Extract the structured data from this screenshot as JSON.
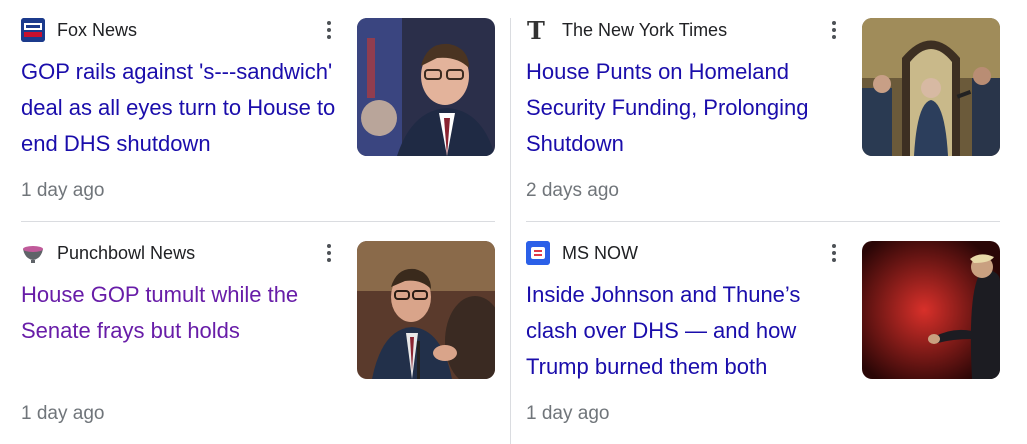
{
  "articles": [
    {
      "source": "Fox News",
      "source_icon": "fox-news-logo-icon",
      "title": "GOP rails against 's---sandwich' deal as all eyes turn to House to end DHS shutdown",
      "time": "1 day ago",
      "visited": false,
      "thumb": "mike-johnson-photo"
    },
    {
      "source": "The New York Times",
      "source_icon": "nyt-logo-icon",
      "title": "House Punts on Homeland Security Funding, Prolonging Shutdown",
      "time": "2 days ago",
      "visited": false,
      "thumb": "capitol-hallway-press-photo"
    },
    {
      "source": "Punchbowl News",
      "source_icon": "punchbowl-logo-icon",
      "title": "House GOP tumult while the Senate frays but holds",
      "time": "1 day ago",
      "visited": true,
      "thumb": "johnson-microphones-photo"
    },
    {
      "source": "MS NOW",
      "source_icon": "ms-now-logo-icon",
      "title": "Inside Johnson and Thune’s clash over DHS — and how Trump burned them both",
      "time": "1 day ago",
      "visited": false,
      "thumb": "trump-red-curtain-photo"
    }
  ],
  "colors": {
    "link": "#1a0dab",
    "visited": "#681da8",
    "meta": "#70757a",
    "source": "#202124",
    "divider": "#dadce0"
  }
}
